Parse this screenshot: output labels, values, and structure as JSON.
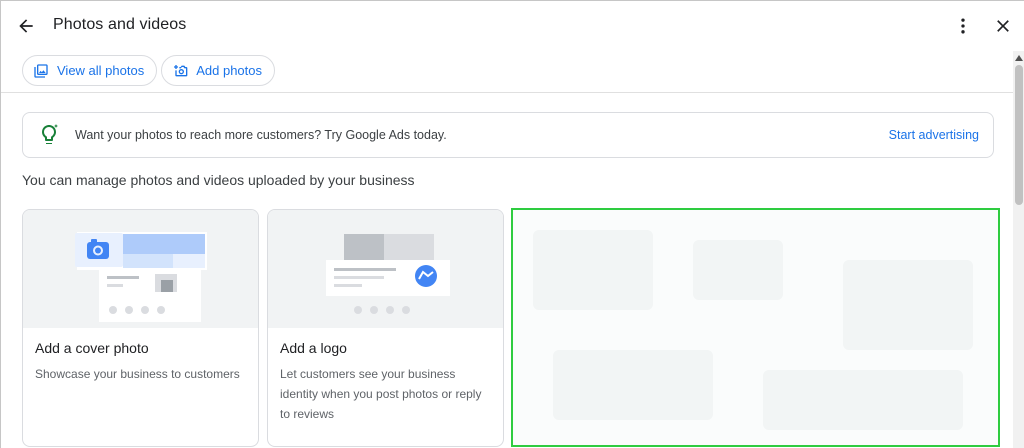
{
  "header": {
    "title": "Photos and videos",
    "back_icon": "arrow-left-icon",
    "more_icon": "more-vert-icon",
    "close_icon": "close-icon"
  },
  "chips": [
    {
      "label": "View all photos",
      "icon": "photo-library-icon"
    },
    {
      "label": "Add photos",
      "icon": "add-photo-icon"
    }
  ],
  "banner": {
    "icon": "lightbulb-icon",
    "text": "Want your photos to reach more customers? Try Google Ads today.",
    "link": "Start advertising"
  },
  "section_text": "You can manage photos and videos uploaded by your business",
  "cards": [
    {
      "title": "Add a cover photo",
      "description": "Showcase your business to customers"
    },
    {
      "title": "Add a logo",
      "description": "Let customers see your business identity when you post photos or reply to reviews"
    }
  ],
  "colors": {
    "accent": "#1a73e8",
    "highlight_border": "#2ecc40",
    "banner_icon_green": "#188038"
  }
}
